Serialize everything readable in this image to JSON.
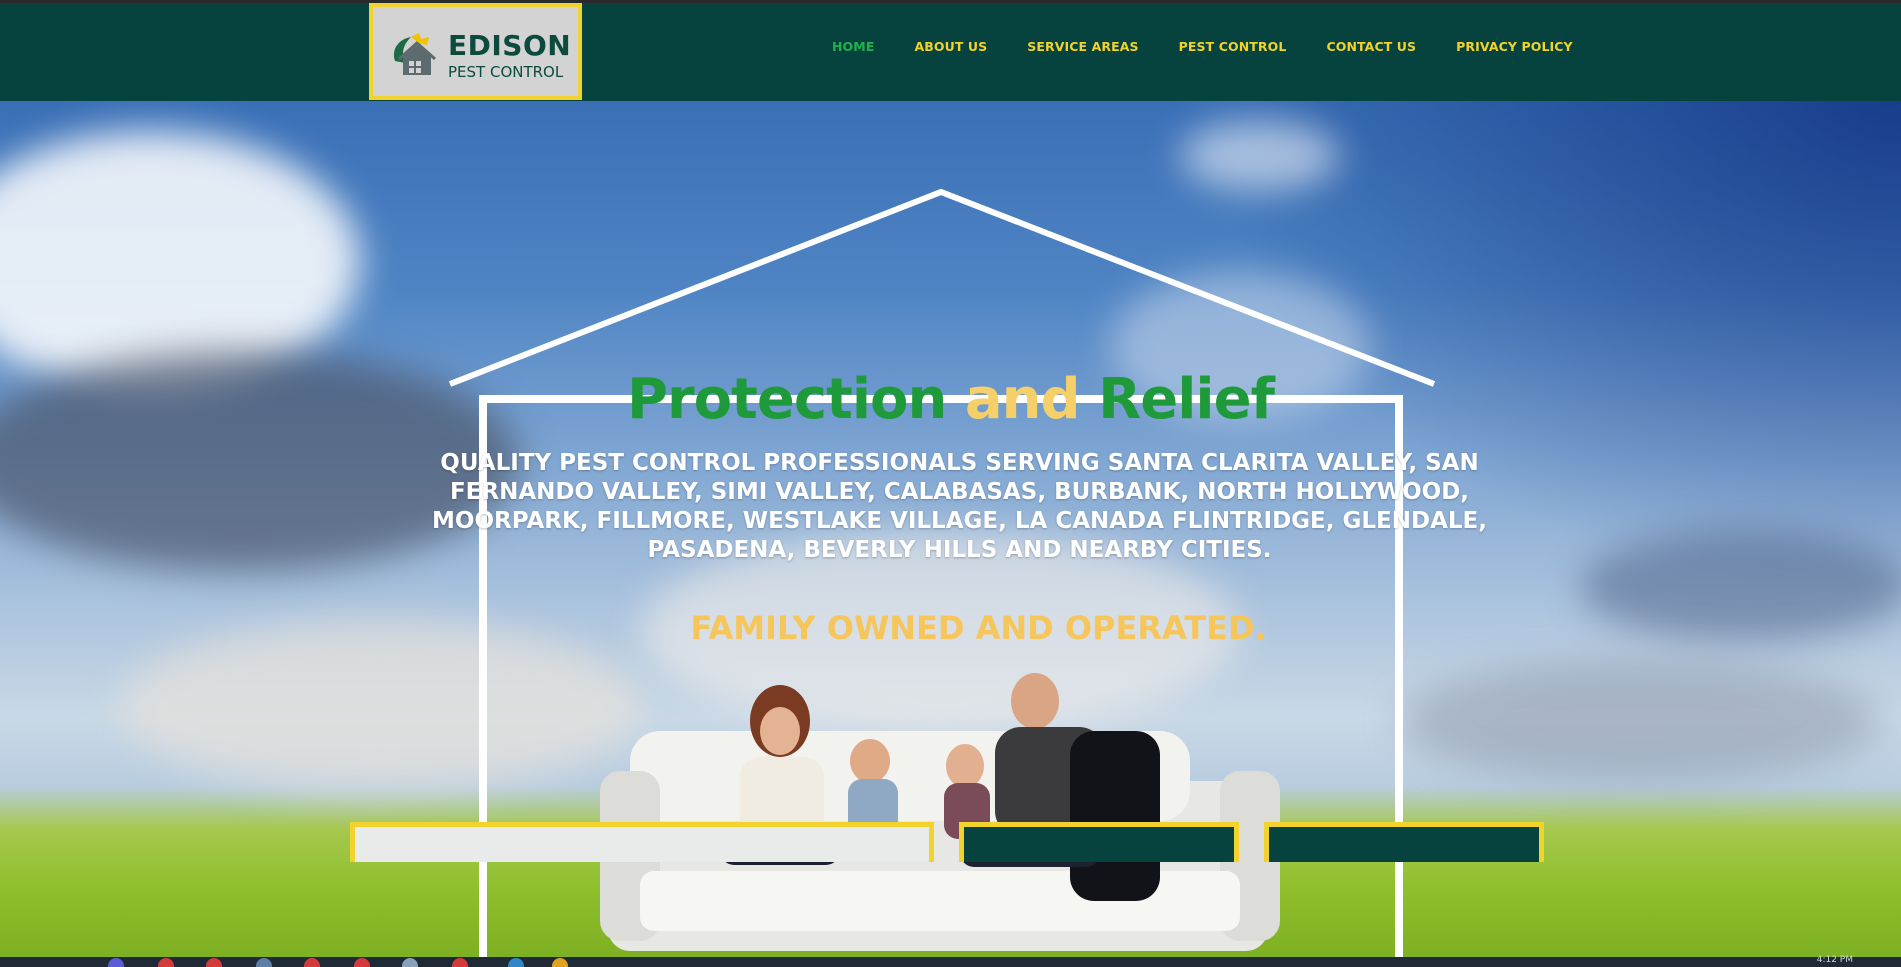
{
  "brand": {
    "name": "EDISON",
    "tagline": "PEST CONTROL"
  },
  "nav": {
    "items": [
      {
        "label": "HOME",
        "active": true
      },
      {
        "label": "ABOUT US",
        "active": false
      },
      {
        "label": "SERVICE AREAS",
        "active": false
      },
      {
        "label": "PEST CONTROL",
        "active": false
      },
      {
        "label": "CONTACT US",
        "active": false
      },
      {
        "label": "PRIVACY POLICY",
        "active": false
      }
    ]
  },
  "hero": {
    "title_part1": "Protection ",
    "title_part2": "and",
    "title_part3": " Relief",
    "description": "QUALITY PEST CONTROL PROFESSIONALS SERVING SANTA CLARITA VALLEY, SAN FERNANDO VALLEY, SIMI VALLEY, CALABASAS, BURBANK, NORTH HOLLYWOOD, MOORPARK, FILLMORE, WESTLAKE VILLAGE, LA CANADA FLINTRIDGE, GLENDALE, PASADENA, BEVERLY HILLS AND NEARBY CITIES.",
    "tagline": "FAMILY OWNED AND OPERATED."
  },
  "taskbar": {
    "clock": "4:12 PM"
  },
  "colors": {
    "header_bg": "#06433e",
    "nav_text": "#f2d22c",
    "nav_active": "#22b24c",
    "title_green": "#1f9a3a",
    "title_yellow": "#f5cf6a",
    "logo_border": "#f2d22c"
  },
  "icons": {
    "logo": "house-leaf-logo-icon"
  }
}
